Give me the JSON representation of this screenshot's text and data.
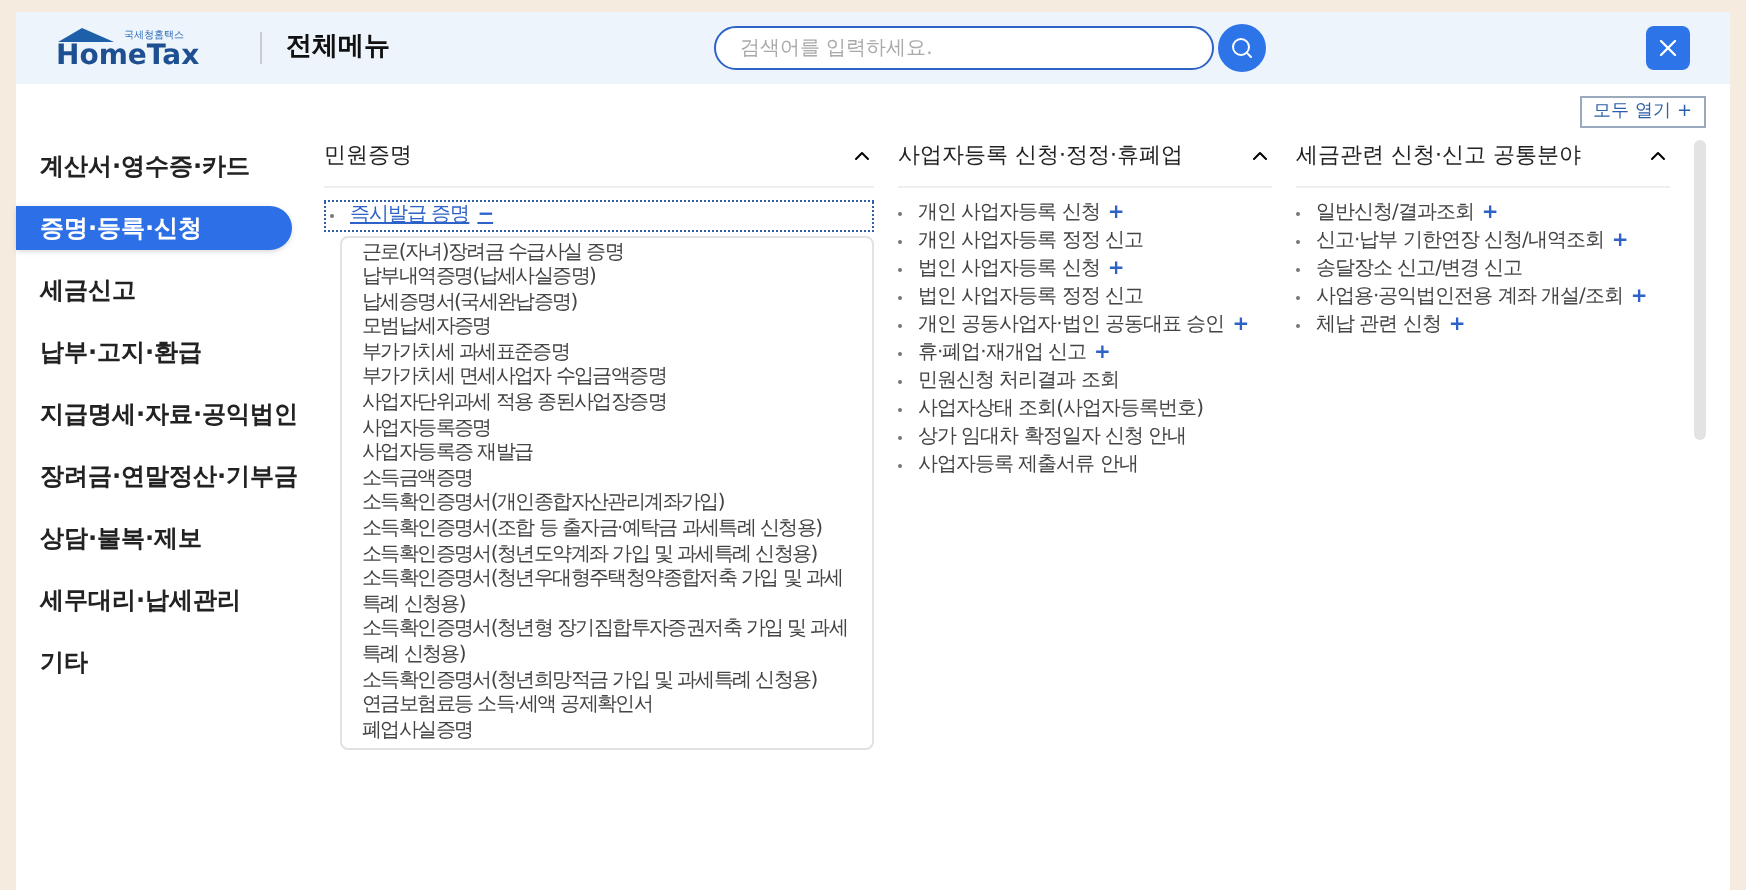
{
  "header": {
    "logo_small": "국세청홈택스",
    "logo_main": "HomeTax",
    "title": "전체메뉴",
    "search": {
      "placeholder": "검색어를 입력하세요."
    }
  },
  "expand_all": "모두 열기 +",
  "sidebar": {
    "items": [
      {
        "label": "계산서·영수증·카드",
        "selected": false
      },
      {
        "label": "증명·등록·신청",
        "selected": true
      },
      {
        "label": "세금신고",
        "selected": false
      },
      {
        "label": "납부·고지·환급",
        "selected": false
      },
      {
        "label": "지급명세·자료·공익법인",
        "selected": false
      },
      {
        "label": "장려금·연말정산·기부금",
        "selected": false
      },
      {
        "label": "상담·불복·제보",
        "selected": false
      },
      {
        "label": "세무대리·납세관리",
        "selected": false
      },
      {
        "label": "기타",
        "selected": false
      }
    ]
  },
  "columns": [
    {
      "title": "민원증명",
      "expanded": true,
      "items": [
        {
          "label": "즉시발급 증명",
          "toggle": "−",
          "expanded": true,
          "children": [
            {
              "label": "근로(자녀)장려금 수급사실 증명"
            },
            {
              "label": "납부내역증명(납세사실증명)"
            },
            {
              "label": "납세증명서(국세완납증명)"
            },
            {
              "label": "모범납세자증명"
            },
            {
              "label": "부가가치세 과세표준증명"
            },
            {
              "label": "부가가치세 면세사업자 수입금액증명"
            },
            {
              "label": "사업자단위과세 적용 종된사업장증명"
            },
            {
              "label": "사업자등록증명"
            },
            {
              "label": "사업자등록증 재발급"
            },
            {
              "label": "소득금액증명"
            },
            {
              "label": "소득확인증명서(개인종합자산관리계좌가입)"
            },
            {
              "label": "소득확인증명서(조합 등 출자금·예탁금 과세특례 신청용)"
            },
            {
              "label": "소득확인증명서(청년도약계좌 가입 및 과세특례 신청용)"
            },
            {
              "label": "소득확인증명서(청년우대형주택청약종합저축 가입 및 과세특례 신청용)"
            },
            {
              "label": "소득확인증명서(청년형 장기집합투자증권저축 가입 및 과세특례 신청용)"
            },
            {
              "label": "소득확인증명서(청년희망적금 가입 및 과세특례 신청용)"
            },
            {
              "label": "연금보험료등 소득·세액 공제확인서"
            },
            {
              "label": "폐업사실증명"
            }
          ]
        }
      ]
    },
    {
      "title": "사업자등록 신청·정정·휴폐업",
      "expanded": true,
      "items": [
        {
          "label": "개인 사업자등록 신청",
          "toggle": "+",
          "expanded": false
        },
        {
          "label": "개인 사업자등록 정정 신고",
          "expanded": false
        },
        {
          "label": "법인 사업자등록 신청",
          "toggle": "+",
          "expanded": false
        },
        {
          "label": "법인 사업자등록 정정 신고",
          "expanded": false
        },
        {
          "label": "개인 공동사업자·법인 공동대표 승인",
          "toggle": "+",
          "expanded": false
        },
        {
          "label": "휴·폐업·재개업 신고",
          "toggle": "+",
          "expanded": false
        },
        {
          "label": "민원신청 처리결과 조회",
          "expanded": false
        },
        {
          "label": "사업자상태 조회(사업자등록번호)",
          "expanded": false
        },
        {
          "label": "상가 임대차 확정일자 신청 안내",
          "expanded": false
        },
        {
          "label": "사업자등록 제출서류 안내",
          "expanded": false
        }
      ]
    },
    {
      "title": "세금관련 신청·신고 공통분야",
      "expanded": true,
      "items": [
        {
          "label": "일반신청/결과조회",
          "toggle": "+",
          "expanded": false
        },
        {
          "label": "신고·납부 기한연장 신청/내역조회",
          "toggle": "+",
          "expanded": false
        },
        {
          "label": "송달장소 신고/변경 신고",
          "expanded": false
        },
        {
          "label": "사업용·공익법인전용 계좌 개설/조회",
          "toggle": "+",
          "expanded": false
        },
        {
          "label": "체납 관련 신청",
          "toggle": "+",
          "expanded": false
        }
      ]
    }
  ]
}
